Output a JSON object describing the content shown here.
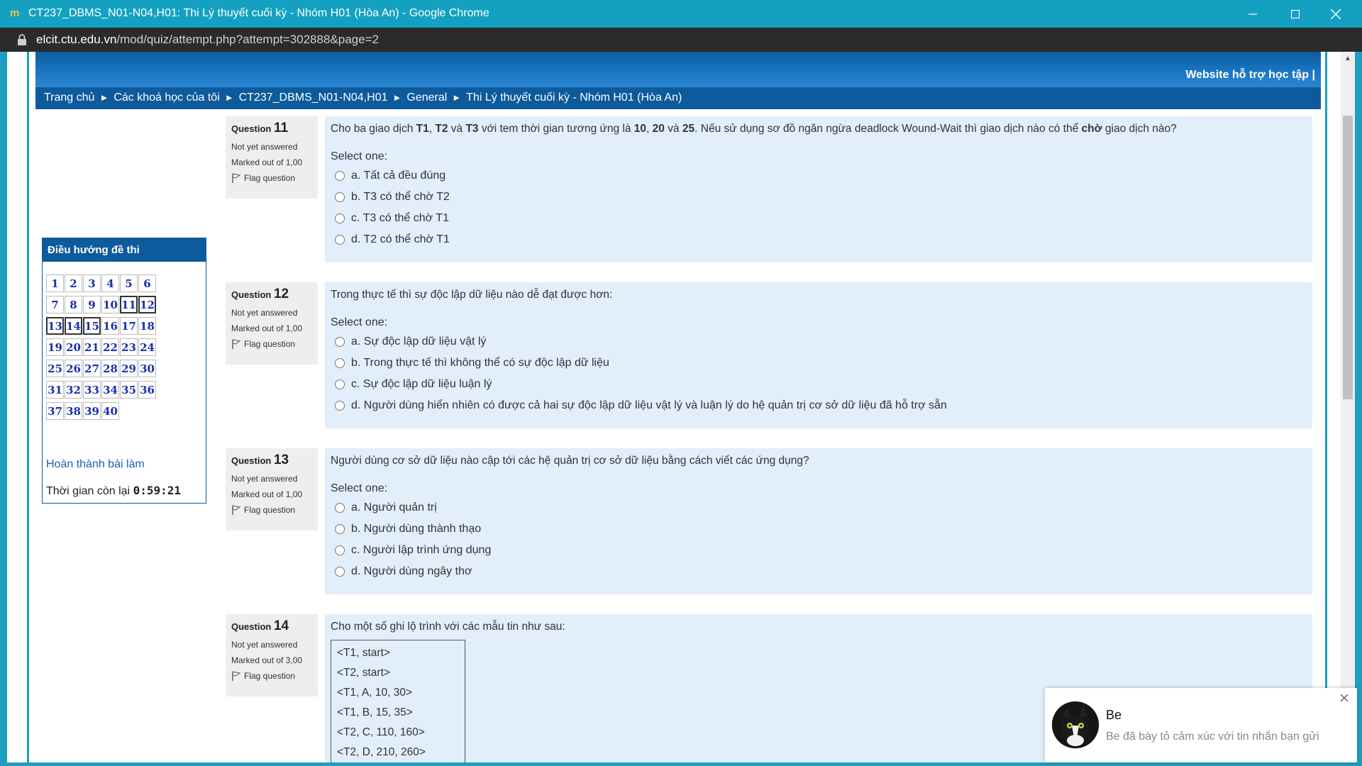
{
  "window": {
    "title": "CT237_DBMS_N01-N04,H01: Thi Lý thuyết cuối kỳ - Nhóm H01 (Hòa An) - Google Chrome"
  },
  "address": {
    "host": "elcit.ctu.edu.vn",
    "path": "/mod/quiz/attempt.php?attempt=302888&page=2"
  },
  "banner": {
    "support_link": "Website hỗ trợ học tập | "
  },
  "breadcrumb": {
    "items": [
      "Trang chủ",
      "Các khoá học của tôi",
      "CT237_DBMS_N01-N04,H01",
      "General",
      "Thi Lý thuyết cuối kỳ - Nhóm H01 (Hòa An)"
    ],
    "separator": "►"
  },
  "quiz_nav": {
    "title": "Điều hướng đề thi",
    "numbers": [
      "1",
      "2",
      "3",
      "4",
      "5",
      "6",
      "7",
      "8",
      "9",
      "10",
      "11",
      "12",
      "13",
      "14",
      "15",
      "16",
      "17",
      "18",
      "19",
      "20",
      "21",
      "22",
      "23",
      "24",
      "25",
      "26",
      "27",
      "28",
      "29",
      "30",
      "31",
      "32",
      "33",
      "34",
      "35",
      "36",
      "37",
      "38",
      "39",
      "40"
    ],
    "current": [
      "11",
      "12",
      "13",
      "14",
      "15"
    ],
    "finish_label": "Hoàn thành bài làm",
    "time_label": "Thời gian còn lại",
    "time_value": "0:59:21"
  },
  "questions": [
    {
      "label": "Question",
      "number": "11",
      "state": "Not yet answered",
      "marks": "Marked out of 1,00",
      "flag": "Flag question",
      "select": "Select one:",
      "options": [
        "a. Tất cả đều đúng",
        "b. T3 có thể chờ T2",
        "c. T3 có thể chờ T1",
        "d. T2 có thể chờ T1"
      ]
    },
    {
      "label": "Question",
      "number": "12",
      "state": "Not yet answered",
      "marks": "Marked out of 1,00",
      "flag": "Flag question",
      "text": "Trong thực tế thì sự độc lập dữ liệu nào dễ đạt được hơn:",
      "select": "Select one:",
      "options": [
        "a. Sự độc lập dữ liệu vật lý",
        "b. Trong thực tế thì không thể có sự độc lập dữ liệu",
        "c. Sự độc lập dữ liệu luận lý",
        "d. Người dùng hiển nhiên có được cả hai sự độc lập dữ liệu vật lý và luận lý do hệ quản trị cơ sở dữ liệu đã hỗ trợ sẵn"
      ]
    },
    {
      "label": "Question",
      "number": "13",
      "state": "Not yet answered",
      "marks": "Marked out of 1,00",
      "flag": "Flag question",
      "text": "Người dùng cơ sở dữ liệu nào cập tới các hệ quản trị cơ sở dữ liệu bằng cách viết các ứng dụng?",
      "select": "Select one:",
      "options": [
        "a. Người quản trị",
        "b. Người dùng thành thạo",
        "c. Người lập trình ứng dụng",
        "d. Người dùng ngây thơ"
      ]
    },
    {
      "label": "Question",
      "number": "14",
      "state": "Not yet answered",
      "marks": "Marked out of 3,00",
      "flag": "Flag question",
      "text": "Cho một số ghi lộ trình với các mẫu tin như sau:",
      "log": [
        "<T1, start>",
        "<T2, start>",
        "<T1, A, 10, 30>",
        "<T1, B, 15, 35>",
        "<T2, C, 110, 160>",
        "<T2, D, 210, 260>"
      ]
    }
  ],
  "q11_parts": {
    "p1": "Cho ba giao dịch ",
    "t1": "T1",
    "p2": ", ",
    "t2": "T2",
    "p3": " và ",
    "t3": "T3",
    "p4": " với tem thời gian tương ứng là ",
    "n1": "10",
    "p5": ", ",
    "n2": "20",
    "p6": " và ",
    "n3": "25",
    "p7": ". Nếu sử dụng sơ đồ ngăn ngừa deadlock Wound-Wait thì giao dịch nào có thể ",
    "w": "chờ",
    "p8": " giao dịch nào?"
  },
  "toast": {
    "name": "Be",
    "message": "Be đã bày tỏ cảm xúc với tin nhắn bạn gửi"
  },
  "colors": {
    "nav_blue": "#0d5a9c",
    "answer_bg": "#e2eefa",
    "title_bar": "#14a1c1",
    "qnum": "#1a2fa8"
  }
}
